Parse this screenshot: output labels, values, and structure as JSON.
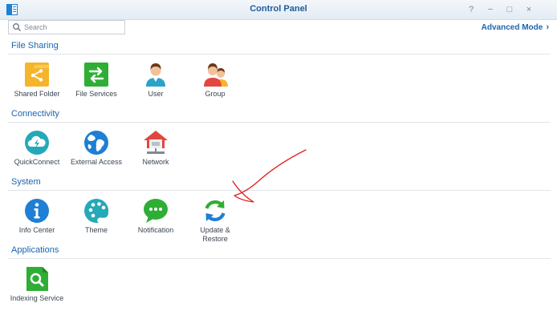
{
  "window": {
    "title": "Control Panel",
    "buttons": {
      "help": "?",
      "minimize": "−",
      "maximize": "□",
      "close": "×"
    }
  },
  "search": {
    "placeholder": "Search",
    "value": ""
  },
  "advanced_mode": {
    "label": "Advanced Mode",
    "chevron": "›"
  },
  "sections": {
    "file_sharing": {
      "title": "File Sharing",
      "items": [
        {
          "label": "Shared Folder",
          "icon": "shared-folder-icon"
        },
        {
          "label": "File Services",
          "icon": "file-services-icon"
        },
        {
          "label": "User",
          "icon": "user-icon"
        },
        {
          "label": "Group",
          "icon": "group-icon"
        }
      ]
    },
    "connectivity": {
      "title": "Connectivity",
      "items": [
        {
          "label": "QuickConnect",
          "icon": "quickconnect-icon"
        },
        {
          "label": "External Access",
          "icon": "globe-icon"
        },
        {
          "label": "Network",
          "icon": "network-house-icon"
        }
      ]
    },
    "system": {
      "title": "System",
      "items": [
        {
          "label": "Info Center",
          "icon": "info-icon"
        },
        {
          "label": "Theme",
          "icon": "palette-icon"
        },
        {
          "label": "Notification",
          "icon": "chat-bubble-icon"
        },
        {
          "label": "Update & Restore",
          "icon": "refresh-icon"
        }
      ]
    },
    "applications": {
      "title": "Applications",
      "items": [
        {
          "label": "Indexing Service",
          "icon": "indexing-search-icon"
        }
      ]
    }
  },
  "colors": {
    "accent": "#1d64b0",
    "annotation_arrow": "#e02020"
  }
}
